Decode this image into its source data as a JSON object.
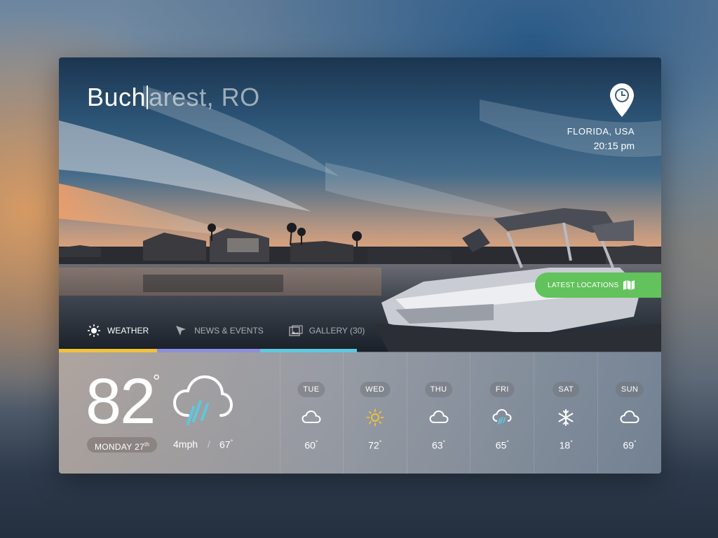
{
  "header": {
    "city_typed": "Buch",
    "city_rest": "arest, RO",
    "location_place": "FLORIDA, USA",
    "location_time": "20:15 pm"
  },
  "latest_locations_label": "LATEST LOCATIONS",
  "tabs": [
    {
      "label": "WEATHER",
      "icon": "sun-icon",
      "active": true
    },
    {
      "label": "NEWS & EVENTS",
      "icon": "pointer-icon",
      "active": false
    },
    {
      "label": "GALLERY (30)",
      "icon": "gallery-icon",
      "active": false
    }
  ],
  "tab_progress_colors": [
    "#f0c23a",
    "#8e8ee0",
    "#5ec8e0"
  ],
  "current": {
    "temp": "82",
    "deg": "°",
    "date": "MONDAY 27",
    "date_suffix": "th",
    "wind": "4mph",
    "separator": "/",
    "low": "67",
    "low_deg": "°",
    "icon": "rain-cloud-icon"
  },
  "forecast": [
    {
      "day": "TUE",
      "icon": "cloud-icon",
      "temp": "60"
    },
    {
      "day": "WED",
      "icon": "sun-icon",
      "temp": "72"
    },
    {
      "day": "THU",
      "icon": "cloud-icon",
      "temp": "63"
    },
    {
      "day": "FRI",
      "icon": "rain-cloud-icon",
      "temp": "65"
    },
    {
      "day": "SAT",
      "icon": "snowflake-icon",
      "temp": "18"
    },
    {
      "day": "SUN",
      "icon": "cloud-icon",
      "temp": "69"
    }
  ],
  "degree": "°",
  "colors": {
    "accent_green": "#62c25c",
    "sun_yellow": "#f0c23a",
    "rain_blue": "#5ec8e0"
  }
}
